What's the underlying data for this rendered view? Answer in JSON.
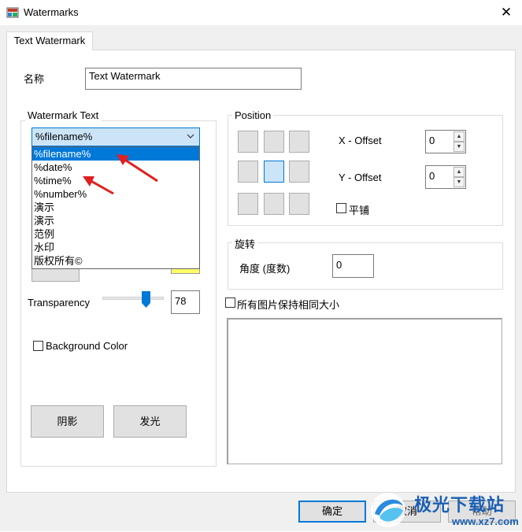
{
  "window": {
    "title": "Watermarks",
    "close_glyph": "✕"
  },
  "tabs": [
    {
      "label": "Text Watermark"
    }
  ],
  "name_field": {
    "label": "名称",
    "value": "Text Watermark"
  },
  "watermark_text": {
    "group_title": "Watermark Text",
    "combo_value": "%filename%",
    "combo_arrow": "⌵",
    "options": [
      "%filename%",
      "%date%",
      "%time%",
      "%number%",
      "演示",
      "演示",
      "范例",
      "水印",
      "版权所有©"
    ],
    "selected_index": 0
  },
  "transparency": {
    "label": "Transparency",
    "value": "78",
    "level_percent": 78
  },
  "background_color": {
    "label": "Background Color",
    "checked": false
  },
  "effects": {
    "shadow_label": "阴影",
    "glow_label": "发光"
  },
  "position": {
    "group_title": "Position",
    "selected_cell": 4,
    "x_offset_label": "X - Offset",
    "x_offset_value": "0",
    "y_offset_label": "Y - Offset",
    "y_offset_value": "0",
    "tile_label": "平铺",
    "tile_checked": false
  },
  "rotation": {
    "group_title": "旋转",
    "angle_label": "角度 (度数)",
    "angle_value": "0"
  },
  "same_size": {
    "label": "所有图片保持相同大小",
    "checked": false
  },
  "footer": {
    "ok_label": "确定",
    "cancel_label": "取消",
    "help_label": "帮助"
  },
  "brand_watermark": {
    "text": "极光下载站",
    "url": "www.xz7.com"
  },
  "colors": {
    "accent": "#0078d7",
    "selection_bg": "#cce4f7",
    "dialog_bg": "#f0f0f0"
  }
}
